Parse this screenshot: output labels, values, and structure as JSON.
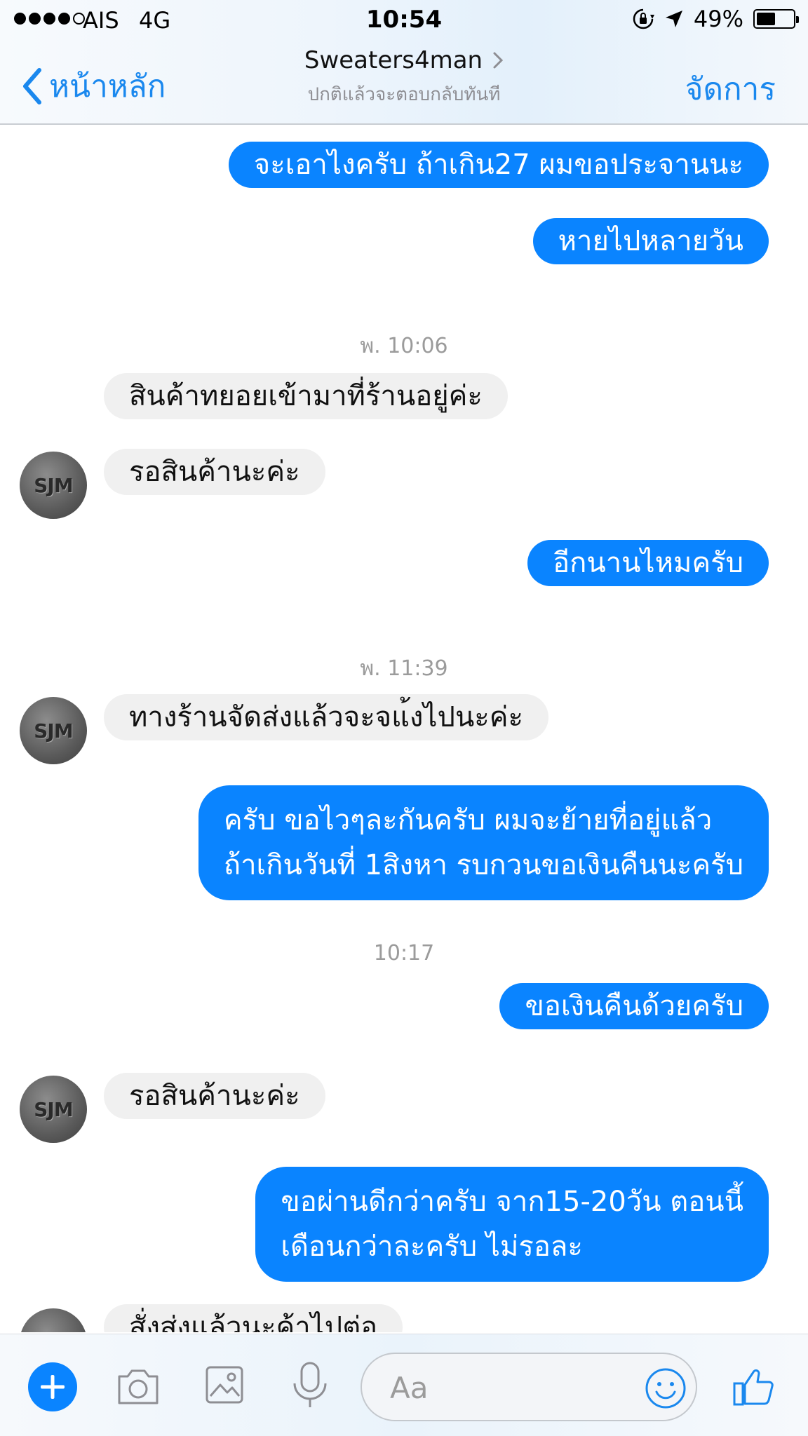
{
  "status_bar": {
    "carrier": "AIS",
    "network": "4G",
    "time": "10:54",
    "battery_percent": "49%",
    "battery_level": 0.49,
    "signal_bars": 4
  },
  "header": {
    "back_label": "หน้าหลัก",
    "title": "Sweaters4man",
    "subtitle": "ปกติแล้วจะตอบกลับทันที",
    "manage_label": "จัดการ"
  },
  "messages": {
    "m1": "จะเอาไงครับ ถ้าเกิน27 ผมขอประจานนะ",
    "m2": "หายไปหลายวัน",
    "t1": "พ. 10:06",
    "m3": "สินค้าทยอยเข้ามาที่ร้านอยู่ค่ะ",
    "m4": "รอสินค้านะค่ะ",
    "m5": "อีกนานไหมครับ",
    "t2": "พ. 11:39",
    "m6": "ทางร้านจัดส่งแล้วจะจแ้งไปนะค่ะ",
    "m7_line1": "ครับ ขอไวๆละกันครับ ผมจะย้ายที่อยู่แล้ว",
    "m7_line2": "ถ้าเกินวันที่ 1สิงหา รบกวนขอเงินคืนนะครับ",
    "t3": "10:17",
    "m8": "ขอเงินคืนด้วยครับ",
    "m9": "รอสินค้านะค่ะ",
    "m10_line1": "ขอผ่านดีกว่าครับ จาก15-20วัน ตอนนี้",
    "m10_line2": "เดือนกว่าละครับ ไม่รอละ",
    "m11_partial": "สั่งส่งแล้วนะค้าไปต่อ"
  },
  "avatar_text": "SJM",
  "composer": {
    "placeholder": "Aa"
  },
  "colors": {
    "accent": "#0a84ff",
    "incoming_bubble": "#f0f0f0",
    "link_blue": "#1a88ee"
  },
  "icons": [
    "plus-icon",
    "camera-icon",
    "image-icon",
    "microphone-icon",
    "smiley-icon",
    "thumbs-up-icon",
    "back-chevron-icon",
    "location-arrow-icon",
    "rotation-lock-icon"
  ]
}
